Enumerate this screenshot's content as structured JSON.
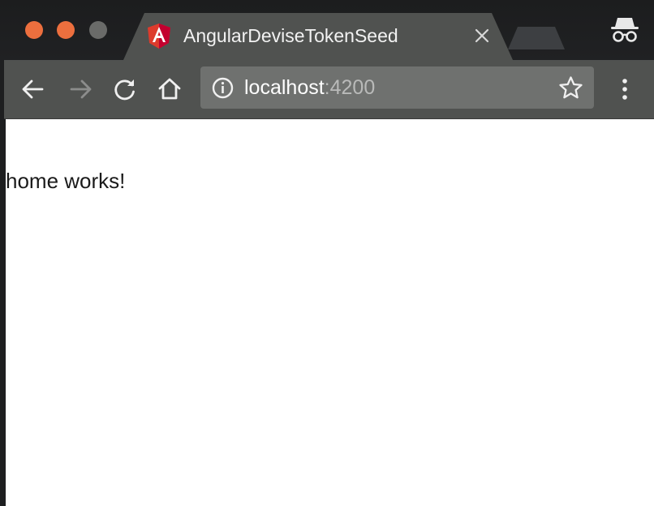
{
  "window": {
    "controls": [
      "close",
      "minimize",
      "maximize"
    ]
  },
  "tab": {
    "title": "AngularDeviseTokenSeed",
    "favicon": "angular-icon",
    "close_icon": "close-icon"
  },
  "toolbar": {
    "back_icon": "arrow-left-icon",
    "forward_icon": "arrow-right-icon",
    "reload_icon": "reload-icon",
    "home_icon": "home-icon",
    "menu_icon": "more-vertical-icon"
  },
  "omnibox": {
    "host": "localhost",
    "port": ":4200",
    "info_icon": "info-icon",
    "bookmark_icon": "star-icon"
  },
  "page": {
    "text": "home works!"
  },
  "colors": {
    "titlebar": "#1e1f20",
    "toolbar": "#505250",
    "omnibox": "#6f716f",
    "angular_red": "#dd3b2c",
    "traffic_orange": "#ec6f3e",
    "traffic_gray": "#6a6b69"
  }
}
